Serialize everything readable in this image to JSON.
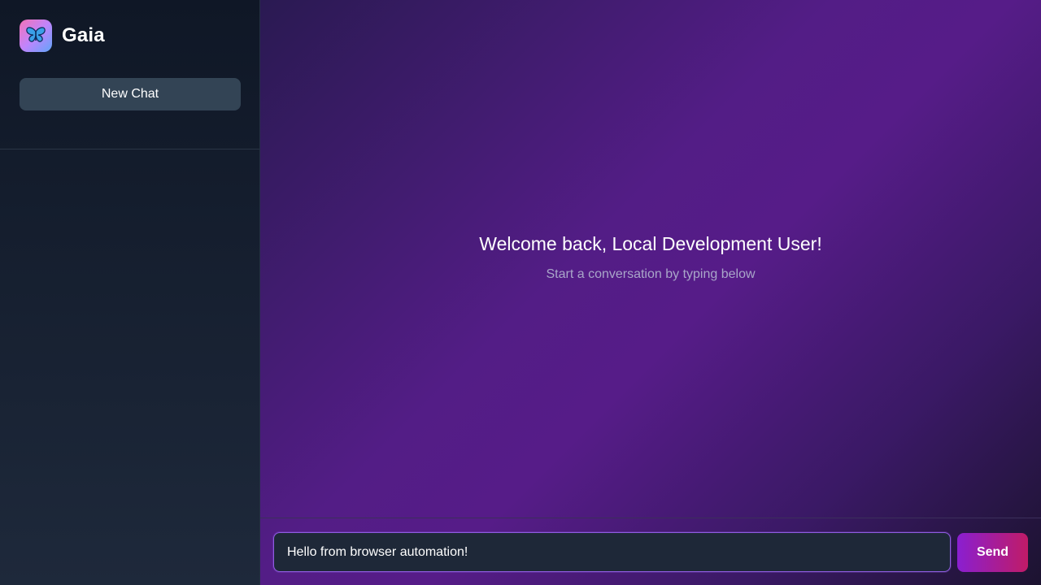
{
  "app": {
    "name": "Gaia",
    "logo_icon": "butterfly-icon",
    "colors": {
      "accent_start": "#8a1fd0",
      "accent_end": "#c01b67",
      "sidebar_bg": "#0f1726",
      "main_bg": "#531d86"
    }
  },
  "sidebar": {
    "new_chat_label": "New Chat"
  },
  "main": {
    "welcome_title": "Welcome back, Local Development User!",
    "welcome_subtitle": "Start a conversation by typing below"
  },
  "composer": {
    "input_value": "Hello from browser automation!",
    "send_label": "Send"
  }
}
